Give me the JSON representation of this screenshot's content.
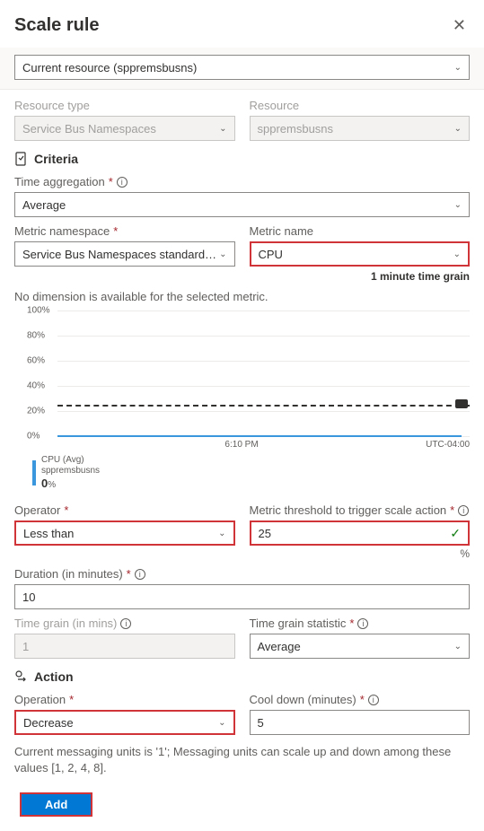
{
  "header": {
    "title": "Scale rule"
  },
  "metric_source": {
    "label": "Current resource (sppremsbusns)"
  },
  "resource": {
    "type_label": "Resource type",
    "type_value": "Service Bus Namespaces",
    "resource_label": "Resource",
    "resource_value": "sppremsbusns"
  },
  "criteria": {
    "heading": "Criteria",
    "time_agg_label": "Time aggregation",
    "time_agg_value": "Average",
    "metric_ns_label": "Metric namespace",
    "metric_ns_value": "Service Bus Namespaces standard me...",
    "metric_name_label": "Metric name",
    "metric_name_value": "CPU",
    "time_grain_note": "1 minute time grain",
    "dim_note": "No dimension is available for the selected metric.",
    "operator_label": "Operator",
    "operator_value": "Less than",
    "threshold_label": "Metric threshold to trigger scale action",
    "threshold_value": "25",
    "threshold_unit": "%",
    "duration_label": "Duration (in minutes)",
    "duration_value": "10",
    "tgrain_label": "Time grain (in mins)",
    "tgrain_value": "1",
    "tgstat_label": "Time grain statistic",
    "tgstat_value": "Average"
  },
  "action": {
    "heading": "Action",
    "operation_label": "Operation",
    "operation_value": "Decrease",
    "cooldown_label": "Cool down (minutes)",
    "cooldown_value": "5",
    "footer_note": "Current messaging units is '1'; Messaging units can scale up and down among these values [1, 2, 4, 8].",
    "add_label": "Add"
  },
  "chart_data": {
    "type": "line",
    "title": "",
    "ylabel": "",
    "ylim": [
      0,
      100
    ],
    "yticks": [
      0,
      20,
      40,
      60,
      80,
      100
    ],
    "ytick_labels": [
      "0%",
      "20%",
      "40%",
      "60%",
      "80%",
      "100%"
    ],
    "threshold": 25,
    "x_center_label": "6:10 PM",
    "x_right_label": "UTC-04:00",
    "series": [
      {
        "name": "CPU (Avg)",
        "resource": "sppremsbusns",
        "current": "0",
        "unit": "%",
        "approx_value": 1
      }
    ]
  }
}
